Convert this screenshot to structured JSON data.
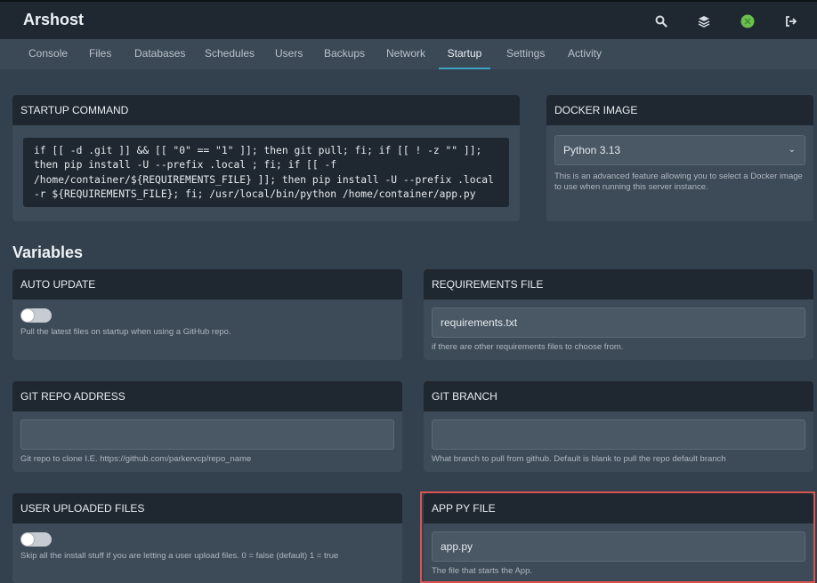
{
  "app": {
    "title": "Arshost"
  },
  "header": {
    "icons": [
      {
        "name": "search-icon"
      },
      {
        "name": "layers-icon"
      },
      {
        "name": "avatar-icon",
        "color": "#6bbf4e"
      },
      {
        "name": "logout-icon"
      }
    ]
  },
  "nav": {
    "tabs": [
      "Console",
      "Files",
      "Databases",
      "Schedules",
      "Users",
      "Backups",
      "Network",
      "Startup",
      "Settings",
      "Activity"
    ],
    "active": "Startup",
    "accent": "#3fa3c4"
  },
  "startup": {
    "title": "STARTUP COMMAND",
    "command_lines": [
      "if [[ -d .git ]] && [[ \"0\" == \"1\" ]]; then git pull; fi; if [[ ! -z \"\" ]];",
      "then pip install -U --prefix .local ; fi; if [[ -f",
      "/home/container/${REQUIREMENTS_FILE} ]]; then pip install -U --prefix .local",
      "-r ${REQUIREMENTS_FILE}; fi; /usr/local/bin/python /home/container/app.py"
    ]
  },
  "docker": {
    "title": "DOCKER IMAGE",
    "selected": "Python 3.13",
    "help_lines": [
      "This is an advanced feature allowing you to select a Docker image",
      "to use when running this server instance."
    ]
  },
  "variables": {
    "title": "Variables",
    "auto_update": {
      "title": "AUTO UPDATE",
      "enabled": false,
      "help": "Pull the latest files on startup when using a GitHub repo."
    },
    "requirements_file": {
      "title": "REQUIREMENTS FILE",
      "value": "requirements.txt",
      "help": "if there are other requirements files to choose from."
    },
    "git_repo": {
      "title": "GIT REPO ADDRESS",
      "value": "",
      "help": "Git repo to clone I.E. https://github.com/parkervcp/repo_name"
    },
    "git_branch": {
      "title": "GIT BRANCH",
      "value": "",
      "help": "What branch to pull from github. Default is blank to pull the repo default branch"
    },
    "user_uploaded": {
      "title": "USER UPLOADED FILES",
      "enabled": false,
      "help": "Skip all the install stuff if you are letting a user upload files. 0 = false (default) 1 = true"
    },
    "app_py": {
      "title": "APP PY FILE",
      "value": "app.py",
      "help": "The file that starts the App.",
      "highlight_color": "#d9534f"
    }
  }
}
